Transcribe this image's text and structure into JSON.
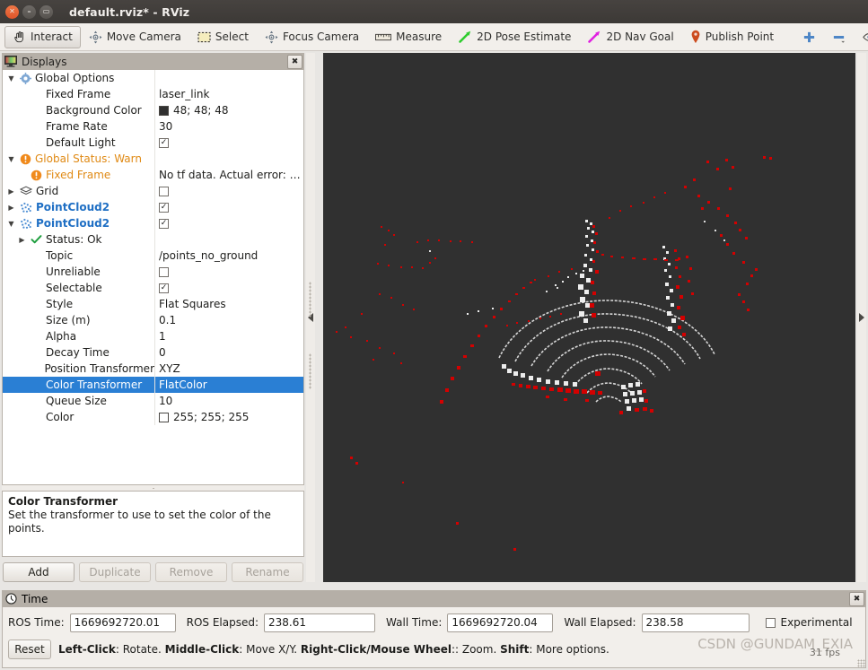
{
  "window": {
    "title": "default.rviz* - RViz",
    "buttons": {
      "close": "×",
      "minimize": "–",
      "maximize": "▭"
    }
  },
  "toolbar": {
    "items": [
      {
        "label": "Interact",
        "icon": "hand-cursor-icon",
        "active": true
      },
      {
        "label": "Move Camera",
        "icon": "move-camera-icon",
        "active": false
      },
      {
        "label": "Select",
        "icon": "select-rect-icon",
        "active": false
      },
      {
        "label": "Focus Camera",
        "icon": "focus-camera-icon",
        "active": false
      },
      {
        "label": "Measure",
        "icon": "ruler-icon",
        "active": false
      },
      {
        "label": "2D Pose Estimate",
        "icon": "green-arrow-icon",
        "active": false
      },
      {
        "label": "2D Nav Goal",
        "icon": "magenta-arrow-icon",
        "active": false
      },
      {
        "label": "Publish Point",
        "icon": "map-pin-icon",
        "active": false
      }
    ],
    "extra": [
      {
        "icon": "plus-icon",
        "label": ""
      },
      {
        "icon": "minus-icon",
        "label": ""
      },
      {
        "icon": "eye-icon",
        "label": ""
      }
    ]
  },
  "displays": {
    "title": "Displays",
    "title_icon": "monitor-icon",
    "close_label": "✖",
    "rows": [
      {
        "indent": 0,
        "arrow": "down",
        "icon": "gear-icon",
        "name": "Global Options",
        "value": "",
        "vtype": "none",
        "style": "plain"
      },
      {
        "indent": 1,
        "arrow": "none",
        "icon": "",
        "name": "Fixed Frame",
        "value": "laser_link",
        "vtype": "text",
        "style": "plain"
      },
      {
        "indent": 1,
        "arrow": "none",
        "icon": "",
        "name": "Background Color",
        "value": "48; 48; 48",
        "vtype": "swatch",
        "swatch": "#303030",
        "style": "plain"
      },
      {
        "indent": 1,
        "arrow": "none",
        "icon": "",
        "name": "Frame Rate",
        "value": "30",
        "vtype": "text",
        "style": "plain"
      },
      {
        "indent": 1,
        "arrow": "none",
        "icon": "",
        "name": "Default Light",
        "value": "",
        "vtype": "checked",
        "style": "plain"
      },
      {
        "indent": 0,
        "arrow": "down",
        "icon": "warning-icon",
        "name": "Global Status: Warn",
        "value": "",
        "vtype": "none",
        "style": "warn"
      },
      {
        "indent": 1,
        "arrow": "none",
        "icon": "warning-icon",
        "name": "Fixed Frame",
        "value": "No tf data.  Actual error: …",
        "vtype": "text",
        "style": "warn"
      },
      {
        "indent": 0,
        "arrow": "right",
        "icon": "grid-icon",
        "name": "Grid",
        "value": "",
        "vtype": "unchecked",
        "style": "plain"
      },
      {
        "indent": 0,
        "arrow": "right",
        "icon": "pointcloud-icon",
        "name": "PointCloud2",
        "value": "",
        "vtype": "checked",
        "style": "blue"
      },
      {
        "indent": 0,
        "arrow": "down",
        "icon": "pointcloud-icon",
        "name": "PointCloud2",
        "value": "",
        "vtype": "checked",
        "style": "blue"
      },
      {
        "indent": 1,
        "arrow": "right",
        "icon": "check-icon",
        "name": "Status: Ok",
        "value": "",
        "vtype": "none",
        "style": "plain"
      },
      {
        "indent": 1,
        "arrow": "none",
        "icon": "",
        "name": "Topic",
        "value": "/points_no_ground",
        "vtype": "text",
        "style": "plain"
      },
      {
        "indent": 1,
        "arrow": "none",
        "icon": "",
        "name": "Unreliable",
        "value": "",
        "vtype": "unchecked",
        "style": "plain"
      },
      {
        "indent": 1,
        "arrow": "none",
        "icon": "",
        "name": "Selectable",
        "value": "",
        "vtype": "checked",
        "style": "plain"
      },
      {
        "indent": 1,
        "arrow": "none",
        "icon": "",
        "name": "Style",
        "value": "Flat Squares",
        "vtype": "text",
        "style": "plain"
      },
      {
        "indent": 1,
        "arrow": "none",
        "icon": "",
        "name": "Size (m)",
        "value": "0.1",
        "vtype": "text",
        "style": "plain"
      },
      {
        "indent": 1,
        "arrow": "none",
        "icon": "",
        "name": "Alpha",
        "value": "1",
        "vtype": "text",
        "style": "plain"
      },
      {
        "indent": 1,
        "arrow": "none",
        "icon": "",
        "name": "Decay Time",
        "value": "0",
        "vtype": "text",
        "style": "plain"
      },
      {
        "indent": 1,
        "arrow": "none",
        "icon": "",
        "name": "Position Transformer",
        "value": "XYZ",
        "vtype": "text",
        "style": "plain"
      },
      {
        "indent": 1,
        "arrow": "none",
        "icon": "",
        "name": "Color Transformer",
        "value": "FlatColor",
        "vtype": "text",
        "style": "plain",
        "selected": true
      },
      {
        "indent": 1,
        "arrow": "none",
        "icon": "",
        "name": "Queue Size",
        "value": "10",
        "vtype": "text",
        "style": "plain"
      },
      {
        "indent": 1,
        "arrow": "none",
        "icon": "",
        "name": "Color",
        "value": "255; 255; 255",
        "vtype": "swatch",
        "swatch": "#ffffff",
        "style": "plain"
      }
    ],
    "description": {
      "heading": "Color Transformer",
      "body": "Set the transformer to use to set the color of the points."
    },
    "buttons": [
      {
        "label": "Add",
        "enabled": true
      },
      {
        "label": "Duplicate",
        "enabled": false
      },
      {
        "label": "Remove",
        "enabled": false
      },
      {
        "label": "Rename",
        "enabled": false
      }
    ]
  },
  "viewport": {
    "background_color": "#303030",
    "collapse_left_icon": "collapse-left-arrow-icon",
    "collapse_right_icon": "collapse-right-arrow-icon",
    "point_colors": {
      "obstacle": "#d40000",
      "ground": "#e8e8e8"
    }
  },
  "time": {
    "title": "Time",
    "title_icon": "clock-icon",
    "close_label": "✖",
    "fields": [
      {
        "label": "ROS Time:",
        "value": "1669692720.01"
      },
      {
        "label": "ROS Elapsed:",
        "value": "238.61"
      },
      {
        "label": "Wall Time:",
        "value": "1669692720.04"
      },
      {
        "label": "Wall Elapsed:",
        "value": "238.58"
      }
    ],
    "experimental": {
      "label": "Experimental",
      "checked": false
    },
    "reset_label": "Reset",
    "hint_segments": [
      {
        "text": "Left-Click",
        "bold": true
      },
      {
        "text": ": Rotate. ",
        "bold": false
      },
      {
        "text": "Middle-Click",
        "bold": true
      },
      {
        "text": ": Move X/Y. ",
        "bold": false
      },
      {
        "text": "Right-Click/Mouse Wheel",
        "bold": true
      },
      {
        "text": ":: Zoom. ",
        "bold": false
      },
      {
        "text": "Shift",
        "bold": true
      },
      {
        "text": ": More options.",
        "bold": false
      }
    ],
    "watermark": "CSDN @GUNDAM_EXIA",
    "fps": "31 fps"
  }
}
